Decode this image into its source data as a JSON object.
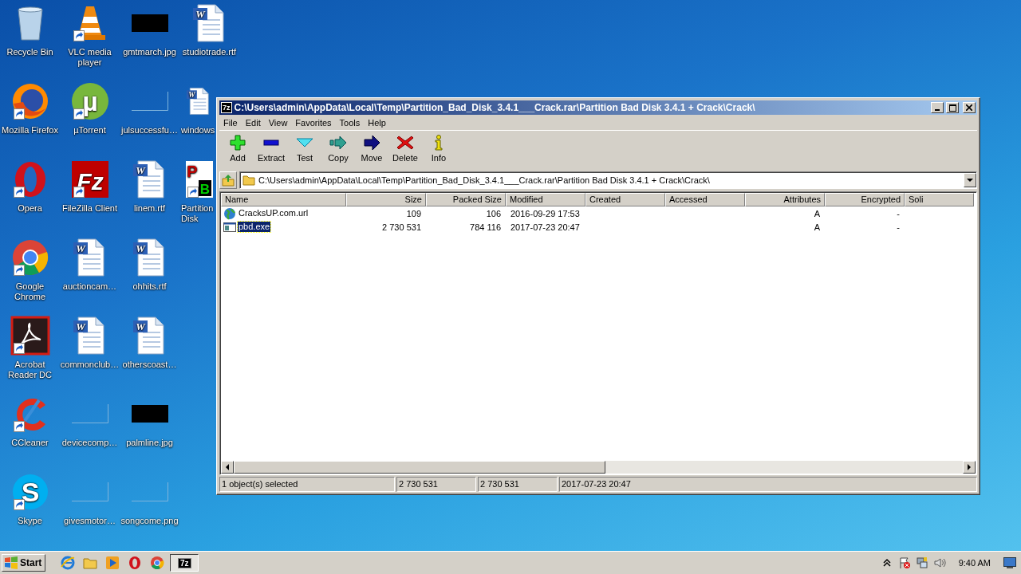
{
  "desktop": {
    "icons": [
      {
        "label": "Recycle Bin",
        "kind": "recycle-bin",
        "shortcut": false
      },
      {
        "label": "Mozilla Firefox",
        "kind": "firefox",
        "shortcut": true
      },
      {
        "label": "Opera",
        "kind": "opera",
        "shortcut": true
      },
      {
        "label": "Google Chrome",
        "kind": "chrome",
        "shortcut": true
      },
      {
        "label": "Acrobat Reader DC",
        "kind": "acrobat",
        "shortcut": true
      },
      {
        "label": "CCleaner",
        "kind": "ccleaner",
        "shortcut": true
      },
      {
        "label": "Skype",
        "kind": "skype",
        "shortcut": true,
        "glyph": "S"
      },
      {
        "label": "VLC media player",
        "kind": "vlc",
        "shortcut": true
      },
      {
        "label": "µTorrent",
        "kind": "utorrent",
        "shortcut": true,
        "glyph": "µ"
      },
      {
        "label": "FileZilla Client",
        "kind": "filezilla",
        "shortcut": true,
        "glyph": "Fz"
      },
      {
        "label": "auctioncam…",
        "kind": "word",
        "shortcut": false,
        "glyph": "W"
      },
      {
        "label": "commonclub…",
        "kind": "word",
        "shortcut": false,
        "glyph": "W"
      },
      {
        "label": "devicecomp…",
        "kind": "faint-thumb",
        "shortcut": false
      },
      {
        "label": "givesmotor…",
        "kind": "faint-thumb",
        "shortcut": false
      },
      {
        "label": "gmtmarch.jpg",
        "kind": "dark-thumb",
        "shortcut": false
      },
      {
        "label": "julsuccessfu…",
        "kind": "faint-thumb",
        "shortcut": false
      },
      {
        "label": "linem.rtf",
        "kind": "word",
        "shortcut": false,
        "glyph": "W"
      },
      {
        "label": "ohhits.rtf",
        "kind": "word",
        "shortcut": false,
        "glyph": "W"
      },
      {
        "label": "otherscoast…",
        "kind": "word",
        "shortcut": false,
        "glyph": "W"
      },
      {
        "label": "palmline.jpg",
        "kind": "dark-thumb",
        "shortcut": false
      },
      {
        "label": "songcome.png",
        "kind": "faint-thumb",
        "shortcut": false
      },
      {
        "label": "studiotrade.rtf",
        "kind": "word",
        "shortcut": false,
        "glyph": "W"
      },
      {
        "label": "windows",
        "kind": "word",
        "shortcut": false,
        "glyph": "W"
      },
      {
        "label": "Partition Disk",
        "kind": "partition",
        "shortcut": true,
        "glyph": "P",
        "glyph_2": "B"
      }
    ]
  },
  "window": {
    "icon_text": "7z",
    "title": "C:\\Users\\admin\\AppData\\Local\\Temp\\Partition_Bad_Disk_3.4.1___Crack.rar\\Partition Bad Disk 3.4.1 + Crack\\Crack\\",
    "menu": [
      "File",
      "Edit",
      "View",
      "Favorites",
      "Tools",
      "Help"
    ],
    "toolbar": [
      {
        "label": "Add",
        "kind": "add"
      },
      {
        "label": "Extract",
        "kind": "extract"
      },
      {
        "label": "Test",
        "kind": "test"
      },
      {
        "label": "Copy",
        "kind": "copy"
      },
      {
        "label": "Move",
        "kind": "move"
      },
      {
        "label": "Delete",
        "kind": "delete"
      },
      {
        "label": "Info",
        "kind": "info"
      }
    ],
    "address": "C:\\Users\\admin\\AppData\\Local\\Temp\\Partition_Bad_Disk_3.4.1___Crack.rar\\Partition Bad Disk 3.4.1 + Crack\\Crack\\",
    "table": {
      "columns": [
        "Name",
        "Size",
        "Packed Size",
        "Modified",
        "Created",
        "Accessed",
        "Attributes",
        "Encrypted",
        "Soli"
      ],
      "rows": [
        {
          "kind": "url",
          "selected": false,
          "cells": [
            "CracksUP.com.url",
            "109",
            "106",
            "2016-09-29 17:53",
            "",
            "",
            "A",
            "-",
            ""
          ]
        },
        {
          "kind": "exe",
          "selected": true,
          "cells": [
            "pbd.exe",
            "2 730 531",
            "784 116",
            "2017-07-23 20:47",
            "",
            "",
            "A",
            "-",
            ""
          ]
        }
      ]
    },
    "status_bar": [
      "1 object(s) selected",
      "2 730 531",
      "2 730 531",
      "2017-07-23 20:47"
    ]
  },
  "taskbar": {
    "start": "Start",
    "quick_launch": [
      {
        "kind": "ie"
      },
      {
        "kind": "explorer"
      },
      {
        "kind": "media"
      },
      {
        "kind": "opera"
      },
      {
        "kind": "chrome"
      }
    ],
    "windows": [
      {
        "icon_text": "7z",
        "active": true
      }
    ],
    "tray": [
      {
        "kind": "chevron"
      },
      {
        "kind": "flag"
      },
      {
        "kind": "network"
      },
      {
        "kind": "speaker"
      }
    ],
    "clock": "9:40 AM"
  }
}
